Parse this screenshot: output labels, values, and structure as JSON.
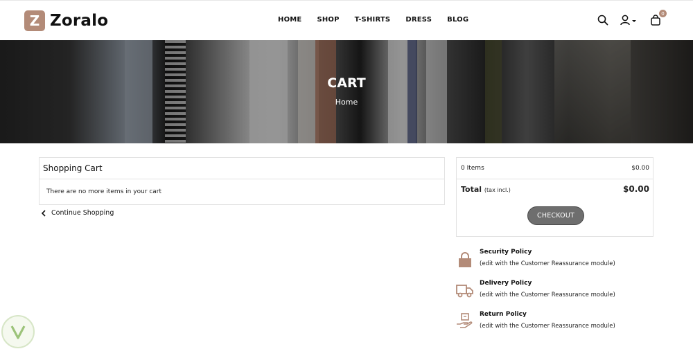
{
  "brand": {
    "logo_letter": "Z",
    "name": "Zoralo",
    "accent": "#b38b78"
  },
  "nav": {
    "items": [
      "HOME",
      "SHOP",
      "T-SHIRTS",
      "DRESS",
      "BLOG"
    ]
  },
  "header_icons": {
    "search": "search-icon",
    "user": "user-icon",
    "cart": "shopping-bag-icon",
    "cart_count": "0"
  },
  "hero": {
    "title": "CART",
    "breadcrumb": "Home"
  },
  "cart": {
    "heading": "Shopping Cart",
    "empty_message": "There are no more items in your cart",
    "continue_label": "Continue Shopping"
  },
  "summary": {
    "items_label": "0 Items",
    "items_value": "$0.00",
    "total_label": "Total",
    "tax_note": "(tax incl.)",
    "total_value": "$0.00",
    "checkout_label": "CHECKOUT"
  },
  "reassurance": [
    {
      "icon": "lock-icon",
      "title": "Security Policy",
      "subtitle": "(edit with the Customer Reassurance module)"
    },
    {
      "icon": "truck-icon",
      "title": "Delivery Policy",
      "subtitle": "(edit with the Customer Reassurance module)"
    },
    {
      "icon": "return-hand-icon",
      "title": "Return Policy",
      "subtitle": "(edit with the Customer Reassurance module)"
    }
  ]
}
